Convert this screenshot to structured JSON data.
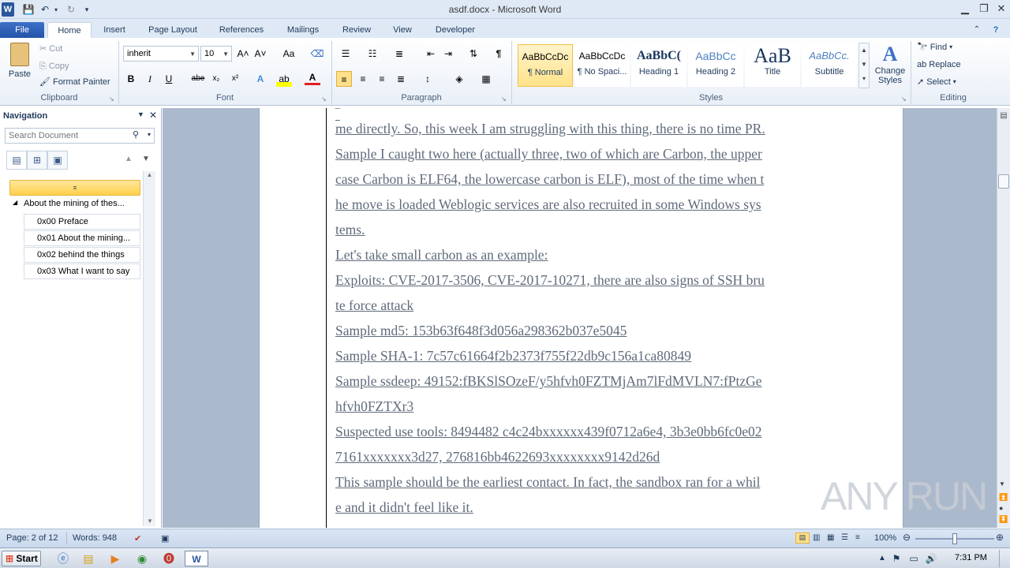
{
  "window": {
    "title": "asdf.docx - Microsoft Word",
    "app_icon": "word-icon",
    "controls": [
      "minimize",
      "restore",
      "close"
    ]
  },
  "quick_access": {
    "items": [
      "save-icon",
      "undo-icon",
      "redo-icon",
      "customize-icon"
    ]
  },
  "ribbon_tabs": [
    "File",
    "Home",
    "Insert",
    "Page Layout",
    "References",
    "Mailings",
    "Review",
    "View",
    "Developer"
  ],
  "active_tab": "Home",
  "clipboard": {
    "paste": "Paste",
    "cut": "Cut",
    "copy": "Copy",
    "format_painter": "Format Painter",
    "label": "Clipboard"
  },
  "font": {
    "name": "inherit",
    "size": "10",
    "label": "Font",
    "buttons": {
      "bold": "B",
      "italic": "I",
      "underline": "U",
      "strike": "abe",
      "sub": "x₂",
      "sup": "x²",
      "grow": "A˄",
      "shrink": "A˅",
      "case": "Aa"
    }
  },
  "paragraph": {
    "label": "Paragraph"
  },
  "styles": {
    "label": "Styles",
    "items": [
      {
        "sample": "AaBbCcDc",
        "name": "¶ Normal"
      },
      {
        "sample": "AaBbCcDc",
        "name": "¶ No Spaci..."
      },
      {
        "sample": "AaBbC(",
        "name": "Heading 1"
      },
      {
        "sample": "AaBbCc",
        "name": "Heading 2"
      },
      {
        "sample": "AaB",
        "name": "Title"
      },
      {
        "sample": "AaBbCc.",
        "name": "Subtitle"
      }
    ],
    "change_styles": "Change Styles"
  },
  "editing": {
    "label": "Editing",
    "find": "Find",
    "replace": "Replace",
    "select": "Select"
  },
  "navigation": {
    "title": "Navigation",
    "search_placeholder": "Search Document",
    "root": "About the mining of thes...",
    "items": [
      "0x00 Preface",
      "0x01 About the mining...",
      "0x02 behind the things",
      "0x03 What I want to say"
    ]
  },
  "document": {
    "lines": [
      "me directly. So, this week I am struggling with this thing, there is no time PR.",
      "Sample I caught two here (actually three, two of which are Carbon, the upper",
      "case Carbon is ELF64, the lowercase carbon is ELF), most of the time when t",
      "he move is loaded Weblogic services are also recruited in some Windows sys",
      "tems.",
      "Let's take small carbon as an example:",
      "Exploits: CVE-2017-3506, CVE-2017-10271, there are also signs of SSH bru",
      "te force attack",
      "Sample md5: 153b63f648f3d056a298362b037e5045",
      "Sample SHA-1: 7c57c61664f2b2373f755f22db9c156a1ca80849",
      "Sample ssdeep: 49152:fBKSlSOzeF/y5hfvh0FZTMjAm7lFdMVLN7:fPtzGe",
      "hfvh0FZTXr3",
      "Suspected use tools: 8494482 c4c24bxxxxxx439f0712a6e4, 3b3e0bb6fc0e02",
      "7161xxxxxxx3d27, 276816bb4622693xxxxxxxx9142d26d",
      "This sample should be the earliest contact. In fact, the sandbox ran for a whil",
      "e and it didn't feel like it."
    ]
  },
  "status": {
    "page": "Page: 2 of 12",
    "words": "Words: 948",
    "zoom": "100%",
    "zoom_level": 1.0
  },
  "taskbar": {
    "start": "Start",
    "clock": "7:31 PM"
  },
  "watermark": "ANY RUN"
}
